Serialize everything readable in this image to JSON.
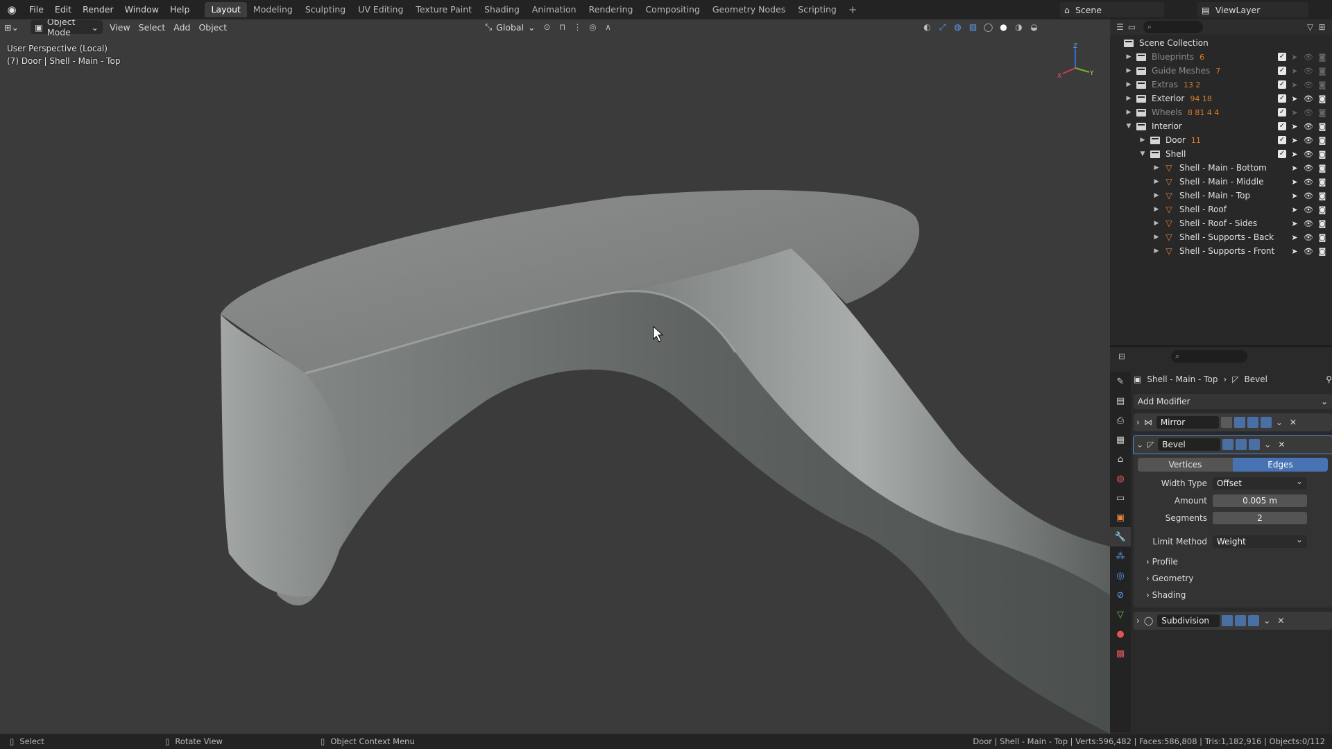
{
  "menubar": {
    "items": [
      "File",
      "Edit",
      "Render",
      "Window",
      "Help"
    ],
    "workspaces": [
      "Layout",
      "Modeling",
      "Sculpting",
      "UV Editing",
      "Texture Paint",
      "Shading",
      "Animation",
      "Rendering",
      "Compositing",
      "Geometry Nodes",
      "Scripting"
    ],
    "active_workspace": "Layout",
    "scene": "Scene",
    "view_layer": "ViewLayer"
  },
  "viewport": {
    "mode": "Object Mode",
    "menus": [
      "View",
      "Select",
      "Add",
      "Object"
    ],
    "orientation": "Global",
    "info_line1": "User Perspective (Local)",
    "info_line2": "(7) Door | Shell - Main - Top",
    "gizmo_axes": [
      "Z",
      "Y",
      "X"
    ]
  },
  "outliner": {
    "root": "Scene Collection",
    "rows": [
      {
        "label": "Blueprints",
        "type": "collection",
        "dim": true,
        "badge": "6"
      },
      {
        "label": "Guide Meshes",
        "type": "collection",
        "dim": true,
        "badge": "7"
      },
      {
        "label": "Extras",
        "type": "collection",
        "dim": true,
        "badge": "13 2"
      },
      {
        "label": "Exterior",
        "type": "collection",
        "dim": false,
        "badge": "94 18"
      },
      {
        "label": "Wheels",
        "type": "collection",
        "dim": true,
        "badge": "8 81 4 4"
      },
      {
        "label": "Interior",
        "type": "collection",
        "dim": false,
        "badge": ""
      },
      {
        "label": "Door",
        "type": "collection",
        "dim": false,
        "badge": "11"
      },
      {
        "label": "Shell",
        "type": "collection",
        "dim": false,
        "badge": ""
      },
      {
        "label": "Shell - Main - Bottom",
        "type": "mesh",
        "dim": false,
        "badge": ""
      },
      {
        "label": "Shell - Main - Middle",
        "type": "mesh",
        "dim": false,
        "badge": ""
      },
      {
        "label": "Shell - Main - Top",
        "type": "mesh",
        "dim": false,
        "badge": ""
      },
      {
        "label": "Shell - Roof",
        "type": "mesh",
        "dim": false,
        "badge": ""
      },
      {
        "label": "Shell - Roof - Sides",
        "type": "mesh",
        "dim": false,
        "badge": ""
      },
      {
        "label": "Shell - Supports - Back",
        "type": "mesh",
        "dim": false,
        "badge": ""
      },
      {
        "label": "Shell - Supports - Front",
        "type": "mesh",
        "dim": false,
        "badge": ""
      }
    ]
  },
  "properties": {
    "object": "Shell - Main - Top",
    "modifier": "Bevel",
    "add_modifier": "Add Modifier",
    "modifiers": [
      "Mirror",
      "Bevel",
      "Subdivision"
    ],
    "bevel": {
      "affect_options": [
        "Vertices",
        "Edges"
      ],
      "affect_selected": "Edges",
      "width_type_label": "Width Type",
      "width_type": "Offset",
      "amount_label": "Amount",
      "amount": "0.005 m",
      "segments_label": "Segments",
      "segments": "2",
      "limit_method_label": "Limit Method",
      "limit_method": "Weight",
      "subpanels": [
        "Profile",
        "Geometry",
        "Shading"
      ]
    }
  },
  "statusbar": {
    "select": "Select",
    "rotate": "Rotate View",
    "context": "Object Context Menu",
    "stats": "Door | Shell - Main - Top | Verts:596,482 | Faces:586,808 | Tris:1,182,916 | Objects:0/112"
  },
  "colors": {
    "accent": "#4772b3",
    "mesh_icon": "#e8843a",
    "viewport_bg": "#3b3b3b"
  }
}
